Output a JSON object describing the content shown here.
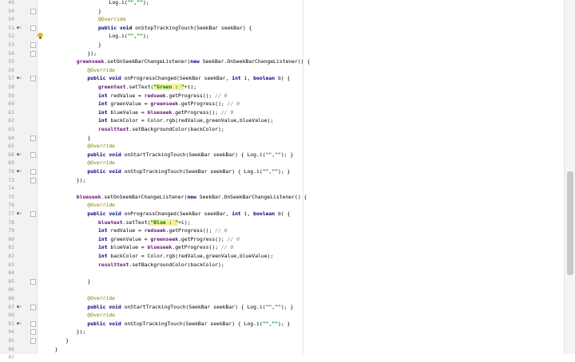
{
  "editor": {
    "colors": {
      "keyword": "#000080",
      "annotation": "#808000",
      "string": "#008000",
      "comment": "#808080",
      "field": "#660e7a",
      "gutter": "#f2f2f2",
      "highlight": "#f3f0a0"
    },
    "lines": [
      {
        "n": "49",
        "indent": 6,
        "marker": "",
        "fold": false,
        "bulb": false,
        "code": [
          {
            "t": "Log.i(",
            "c": ""
          },
          {
            "t": "\"\"",
            "c": "st"
          },
          {
            "t": ",",
            "c": ""
          },
          {
            "t": "\"\"",
            "c": "st"
          },
          {
            "t": ");",
            "c": ""
          }
        ]
      },
      {
        "n": "50",
        "indent": 5,
        "marker": "",
        "fold": true,
        "bulb": false,
        "code": [
          {
            "t": "}",
            "c": ""
          }
        ]
      },
      {
        "n": "50",
        "indent": 5,
        "marker": "",
        "fold": false,
        "bulb": false,
        "code": [
          {
            "t": "@Override",
            "c": "an"
          }
        ]
      },
      {
        "n": "51",
        "indent": 5,
        "marker": "override",
        "fold": true,
        "bulb": false,
        "code": [
          {
            "t": "public void ",
            "c": "kw"
          },
          {
            "t": "onStopTrackingTouch(SeekBar seekBar) {",
            "c": ""
          }
        ]
      },
      {
        "n": "52",
        "indent": 6,
        "marker": "",
        "fold": false,
        "bulb": true,
        "code": [
          {
            "t": "Log.i(",
            "c": ""
          },
          {
            "t": "\"\"",
            "c": "st"
          },
          {
            "t": ",",
            "c": ""
          },
          {
            "t": "\"\"",
            "c": "st"
          },
          {
            "t": ");",
            "c": ""
          }
        ]
      },
      {
        "n": "53",
        "indent": 5,
        "marker": "",
        "fold": true,
        "bulb": false,
        "code": [
          {
            "t": "}",
            "c": ""
          }
        ]
      },
      {
        "n": "54",
        "indent": 4,
        "marker": "",
        "fold": true,
        "bulb": false,
        "code": [
          {
            "t": "});",
            "c": ""
          }
        ]
      },
      {
        "n": "55",
        "indent": 3,
        "marker": "",
        "fold": false,
        "bulb": false,
        "code": [
          {
            "t": "greenseek",
            "c": "fd"
          },
          {
            "t": ".setOnSeekBarChangeListener(",
            "c": ""
          },
          {
            "t": "new ",
            "c": "kw"
          },
          {
            "t": "SeekBar.OnSeekBarChangeListener() {",
            "c": ""
          }
        ]
      },
      {
        "n": "56",
        "indent": 4,
        "marker": "",
        "fold": false,
        "bulb": false,
        "code": [
          {
            "t": "@Override",
            "c": "an"
          }
        ]
      },
      {
        "n": "57",
        "indent": 4,
        "marker": "override",
        "fold": true,
        "bulb": false,
        "code": [
          {
            "t": "public void ",
            "c": "kw"
          },
          {
            "t": "onProgressChanged(SeekBar seekBar, ",
            "c": ""
          },
          {
            "t": "int ",
            "c": "kw"
          },
          {
            "t": "i, ",
            "c": ""
          },
          {
            "t": "boolean ",
            "c": "kw"
          },
          {
            "t": "b) {",
            "c": ""
          }
        ]
      },
      {
        "n": "58",
        "indent": 5,
        "marker": "",
        "fold": false,
        "bulb": false,
        "code": [
          {
            "t": "greentext",
            "c": "fd"
          },
          {
            "t": ".setText(",
            "c": ""
          },
          {
            "t": "\"Green : \"",
            "c": "st hl"
          },
          {
            "t": "+i);",
            "c": ""
          }
        ]
      },
      {
        "n": "59",
        "indent": 5,
        "marker": "",
        "fold": false,
        "bulb": false,
        "code": [
          {
            "t": "int ",
            "c": "kw"
          },
          {
            "t": "redValue = ",
            "c": ""
          },
          {
            "t": "redseek",
            "c": "fd"
          },
          {
            "t": ".getProgress(); ",
            "c": ""
          },
          {
            "t": "// 0",
            "c": "cm"
          }
        ]
      },
      {
        "n": "60",
        "indent": 5,
        "marker": "",
        "fold": false,
        "bulb": false,
        "code": [
          {
            "t": "int ",
            "c": "kw"
          },
          {
            "t": "greenValue = ",
            "c": ""
          },
          {
            "t": "greenseek",
            "c": "fd"
          },
          {
            "t": ".getProgress(); ",
            "c": ""
          },
          {
            "t": "// 0",
            "c": "cm"
          }
        ]
      },
      {
        "n": "61",
        "indent": 5,
        "marker": "",
        "fold": false,
        "bulb": false,
        "code": [
          {
            "t": "int ",
            "c": "kw"
          },
          {
            "t": "blueValue = ",
            "c": ""
          },
          {
            "t": "blueseek",
            "c": "fd"
          },
          {
            "t": ".getProgress(); ",
            "c": ""
          },
          {
            "t": "// 0",
            "c": "cm"
          }
        ]
      },
      {
        "n": "62",
        "indent": 5,
        "marker": "",
        "fold": false,
        "bulb": false,
        "code": [
          {
            "t": "int ",
            "c": "kw"
          },
          {
            "t": "backColor = Color.rgb(redValue,greenValue,blueValue);",
            "c": ""
          }
        ]
      },
      {
        "n": "63",
        "indent": 5,
        "marker": "",
        "fold": false,
        "bulb": false,
        "code": [
          {
            "t": "resulttext",
            "c": "fd"
          },
          {
            "t": ".setBackgroundColor(backColor);",
            "c": ""
          }
        ]
      },
      {
        "n": "64",
        "indent": 4,
        "marker": "",
        "fold": true,
        "bulb": false,
        "code": [
          {
            "t": "}",
            "c": ""
          }
        ]
      },
      {
        "n": "65",
        "indent": 4,
        "marker": "",
        "fold": false,
        "bulb": false,
        "code": [
          {
            "t": "@Override",
            "c": "an"
          }
        ]
      },
      {
        "n": "66",
        "indent": 4,
        "marker": "override",
        "fold": true,
        "bulb": false,
        "code": [
          {
            "t": "public void ",
            "c": "kw"
          },
          {
            "t": "onStartTrackingTouch(SeekBar seekBar) { Log.i(",
            "c": ""
          },
          {
            "t": "\"\"",
            "c": "st"
          },
          {
            "t": ",",
            "c": ""
          },
          {
            "t": "\"\"",
            "c": "st"
          },
          {
            "t": "); }",
            "c": ""
          }
        ]
      },
      {
        "n": "69",
        "indent": 4,
        "marker": "",
        "fold": false,
        "bulb": false,
        "code": [
          {
            "t": "@Override",
            "c": "an"
          }
        ]
      },
      {
        "n": "70",
        "indent": 4,
        "marker": "override",
        "fold": true,
        "bulb": false,
        "code": [
          {
            "t": "public void ",
            "c": "kw"
          },
          {
            "t": "onStopTrackingTouch(SeekBar seekBar) { Log.i(",
            "c": ""
          },
          {
            "t": "\"\"",
            "c": "st"
          },
          {
            "t": ",",
            "c": ""
          },
          {
            "t": "\"\"",
            "c": "st"
          },
          {
            "t": "); }",
            "c": ""
          }
        ]
      },
      {
        "n": "73",
        "indent": 3,
        "marker": "",
        "fold": true,
        "bulb": false,
        "code": [
          {
            "t": "});",
            "c": ""
          }
        ]
      },
      {
        "n": "74",
        "indent": 0,
        "marker": "",
        "fold": false,
        "bulb": false,
        "code": []
      },
      {
        "n": "75",
        "indent": 3,
        "marker": "",
        "fold": false,
        "bulb": false,
        "code": [
          {
            "t": "blueseek",
            "c": "fd"
          },
          {
            "t": ".setOnSeekBarChangeListener(",
            "c": ""
          },
          {
            "t": "new ",
            "c": "kw"
          },
          {
            "t": "SeekBar.OnSeekBarChangeListener() {",
            "c": ""
          }
        ]
      },
      {
        "n": "76",
        "indent": 4,
        "marker": "",
        "fold": false,
        "bulb": false,
        "code": [
          {
            "t": "@Override",
            "c": "an"
          }
        ]
      },
      {
        "n": "77",
        "indent": 4,
        "marker": "override",
        "fold": true,
        "bulb": false,
        "code": [
          {
            "t": "public void ",
            "c": "kw"
          },
          {
            "t": "onProgressChanged(SeekBar seekBar, ",
            "c": ""
          },
          {
            "t": "int ",
            "c": "kw"
          },
          {
            "t": "i, ",
            "c": ""
          },
          {
            "t": "boolean ",
            "c": "kw"
          },
          {
            "t": "b) {",
            "c": ""
          }
        ]
      },
      {
        "n": "78",
        "indent": 5,
        "marker": "",
        "fold": false,
        "bulb": false,
        "code": [
          {
            "t": "bluetext",
            "c": "fd"
          },
          {
            "t": ".setText(",
            "c": ""
          },
          {
            "t": "\"Blue : \"",
            "c": "st hl"
          },
          {
            "t": "+i);",
            "c": ""
          }
        ]
      },
      {
        "n": "79",
        "indent": 5,
        "marker": "",
        "fold": false,
        "bulb": false,
        "code": [
          {
            "t": "int ",
            "c": "kw"
          },
          {
            "t": "redValue = ",
            "c": ""
          },
          {
            "t": "redseek",
            "c": "fd"
          },
          {
            "t": ".getProgress(); ",
            "c": ""
          },
          {
            "t": "// 0",
            "c": "cm"
          }
        ]
      },
      {
        "n": "80",
        "indent": 5,
        "marker": "",
        "fold": false,
        "bulb": false,
        "code": [
          {
            "t": "int ",
            "c": "kw"
          },
          {
            "t": "greenValue = ",
            "c": ""
          },
          {
            "t": "greenseek",
            "c": "fd"
          },
          {
            "t": ".getProgress(); ",
            "c": ""
          },
          {
            "t": "// 0",
            "c": "cm"
          }
        ]
      },
      {
        "n": "81",
        "indent": 5,
        "marker": "",
        "fold": false,
        "bulb": false,
        "code": [
          {
            "t": "int ",
            "c": "kw"
          },
          {
            "t": "blueValue = ",
            "c": ""
          },
          {
            "t": "blueseek",
            "c": "fd"
          },
          {
            "t": ".getProgress(); ",
            "c": ""
          },
          {
            "t": "// 0",
            "c": "cm"
          }
        ]
      },
      {
        "n": "82",
        "indent": 5,
        "marker": "",
        "fold": false,
        "bulb": false,
        "code": [
          {
            "t": "int ",
            "c": "kw"
          },
          {
            "t": "backColor = Color.rgb(redValue,greenValue,blueValue);",
            "c": ""
          }
        ]
      },
      {
        "n": "83",
        "indent": 5,
        "marker": "",
        "fold": false,
        "bulb": false,
        "code": [
          {
            "t": "resulttext",
            "c": "fd"
          },
          {
            "t": ".setBackgroundColor(backColor);",
            "c": ""
          }
        ]
      },
      {
        "n": "84",
        "indent": 0,
        "marker": "",
        "fold": false,
        "bulb": false,
        "code": []
      },
      {
        "n": "85",
        "indent": 4,
        "marker": "",
        "fold": true,
        "bulb": false,
        "code": [
          {
            "t": "}",
            "c": ""
          }
        ]
      },
      {
        "n": "86",
        "indent": 0,
        "marker": "",
        "fold": false,
        "bulb": false,
        "code": []
      },
      {
        "n": "86",
        "indent": 4,
        "marker": "",
        "fold": false,
        "bulb": false,
        "code": [
          {
            "t": "@Override",
            "c": "an"
          }
        ]
      },
      {
        "n": "87",
        "indent": 4,
        "marker": "override",
        "fold": true,
        "bulb": false,
        "code": [
          {
            "t": "public void ",
            "c": "kw"
          },
          {
            "t": "onStartTrackingTouch(SeekBar seekBar) { Log.i(",
            "c": ""
          },
          {
            "t": "\"\"",
            "c": "st"
          },
          {
            "t": ",",
            "c": ""
          },
          {
            "t": "\"\"",
            "c": "st"
          },
          {
            "t": "); }",
            "c": ""
          }
        ]
      },
      {
        "n": "90",
        "indent": 4,
        "marker": "",
        "fold": false,
        "bulb": false,
        "code": [
          {
            "t": "@Override",
            "c": "an"
          }
        ]
      },
      {
        "n": "91",
        "indent": 4,
        "marker": "override",
        "fold": true,
        "bulb": false,
        "code": [
          {
            "t": "public void ",
            "c": "kw"
          },
          {
            "t": "onStopTrackingTouch(SeekBar seekBar) { Log.i(",
            "c": ""
          },
          {
            "t": "\"\"",
            "c": "st"
          },
          {
            "t": ",",
            "c": ""
          },
          {
            "t": "\"\"",
            "c": "st"
          },
          {
            "t": "); }",
            "c": ""
          }
        ]
      },
      {
        "n": "94",
        "indent": 3,
        "marker": "",
        "fold": true,
        "bulb": false,
        "code": [
          {
            "t": "});",
            "c": ""
          }
        ]
      },
      {
        "n": "95",
        "indent": 2,
        "marker": "",
        "fold": true,
        "bulb": false,
        "code": [
          {
            "t": "}",
            "c": ""
          }
        ]
      },
      {
        "n": "96",
        "indent": 1,
        "marker": "",
        "fold": false,
        "bulb": false,
        "code": [
          {
            "t": "}",
            "c": ""
          }
        ]
      },
      {
        "n": "97",
        "indent": 0,
        "marker": "",
        "fold": false,
        "bulb": false,
        "code": []
      }
    ]
  }
}
